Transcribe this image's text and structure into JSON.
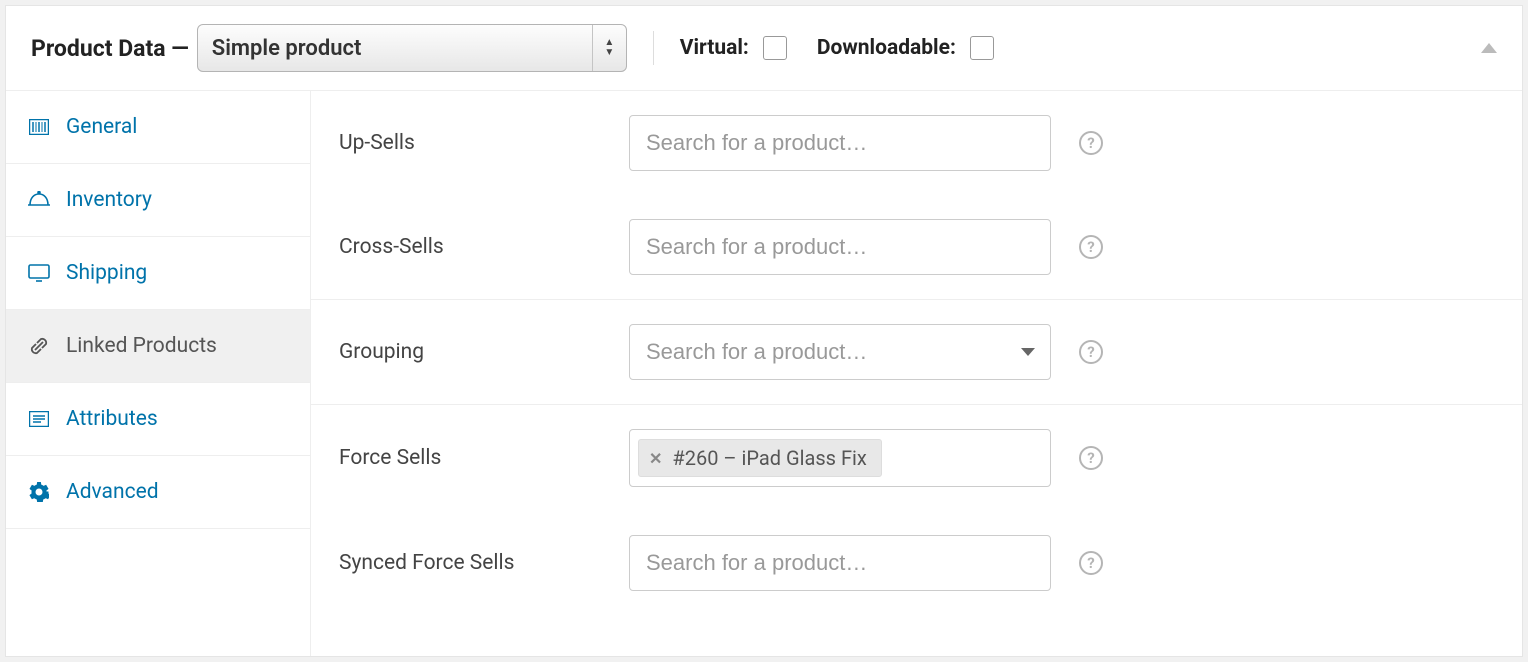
{
  "header": {
    "title": "Product Data —",
    "product_type": "Simple product",
    "virtual_label": "Virtual:",
    "downloadable_label": "Downloadable:"
  },
  "tabs": {
    "general": "General",
    "inventory": "Inventory",
    "shipping": "Shipping",
    "linked_products": "Linked Products",
    "attributes": "Attributes",
    "advanced": "Advanced"
  },
  "fields": {
    "up_sells": {
      "label": "Up-Sells",
      "placeholder": "Search for a product…"
    },
    "cross_sells": {
      "label": "Cross-Sells",
      "placeholder": "Search for a product…"
    },
    "grouping": {
      "label": "Grouping",
      "placeholder": "Search for a product…"
    },
    "force_sells": {
      "label": "Force Sells",
      "tag": "#260 – iPad Glass Fix"
    },
    "synced_force_sells": {
      "label": "Synced Force Sells",
      "placeholder": "Search for a product…"
    }
  },
  "help_char": "?"
}
